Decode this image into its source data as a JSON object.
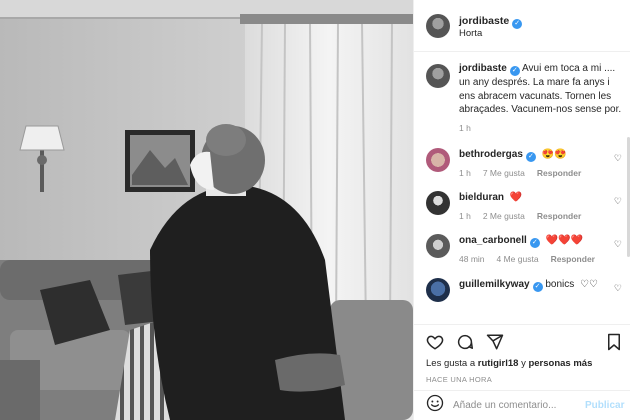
{
  "header": {
    "username": "jordibaste",
    "location": "Horta",
    "verified_mark": "✓"
  },
  "caption": {
    "username": "jordibaste",
    "text": "Avui em toca a mi .... un any després. La mare fa anys i ens abracem vacunats. Tornen les abraçades. Vacunem-nos sense por.",
    "time": "1 h"
  },
  "comments": [
    {
      "username": "bethrodergas",
      "text": "",
      "emoji": "😍😍",
      "time": "1 h",
      "likes": "7 Me gusta",
      "reply": "Responder",
      "verified": true
    },
    {
      "username": "bielduran",
      "text": "",
      "emoji": "❤️",
      "time": "1 h",
      "likes": "2 Me gusta",
      "reply": "Responder",
      "verified": false
    },
    {
      "username": "ona_carbonell",
      "text": "",
      "emoji": "❤️❤️❤️",
      "time": "48 min",
      "likes": "4 Me gusta",
      "reply": "Responder",
      "verified": true
    },
    {
      "username": "guillemilkyway",
      "text": "bonics",
      "emoji": "♡♡",
      "time": "",
      "likes": "",
      "reply": "",
      "verified": true
    }
  ],
  "actions": {
    "likes_prefix": "Les gusta a",
    "likes_user": "rutigirl18",
    "likes_joiner": "y",
    "likes_others": "personas más",
    "timestamp": "HACE UNA HORA"
  },
  "add_comment": {
    "placeholder": "Añade un comentario...",
    "post_label": "Publicar"
  },
  "icons": {
    "like": "heart-icon",
    "comment": "comment-icon",
    "share": "share-icon",
    "save": "bookmark-icon",
    "emoji": "smiley-icon",
    "comment_like": "small-heart-icon"
  },
  "colors": {
    "verified": "#3897f0",
    "muted": "#8e8e8e",
    "post_button": "#b2dffc",
    "heart_red": "#ed4956"
  }
}
